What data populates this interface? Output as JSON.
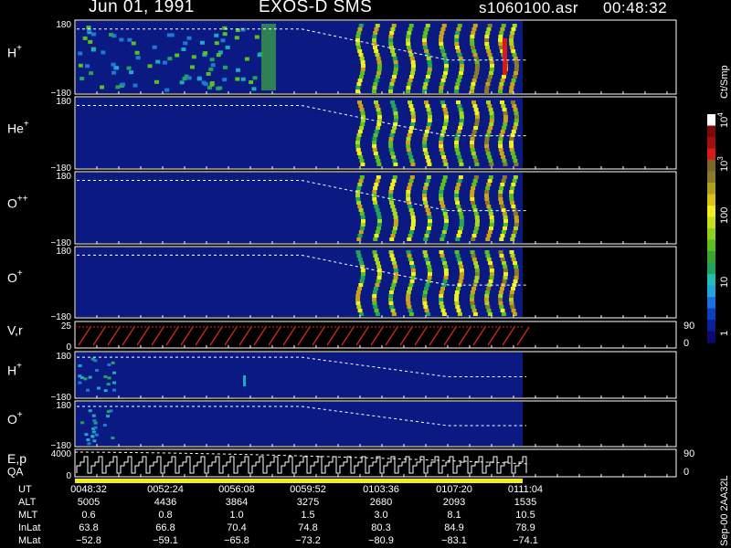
{
  "header": {
    "date": "Jun 01, 1991",
    "mission": "EXOS-D SMS",
    "file": "s1060100.asr",
    "time": "00:48:32"
  },
  "colorbar": {
    "unit": "Ct/Smp",
    "ticks": [
      "1",
      "10",
      "100",
      "10",
      "10"
    ],
    "tick_exponents": [
      "",
      "",
      "",
      "3",
      "4"
    ],
    "colors": [
      "#0b0b6e",
      "#0a1f9a",
      "#0a3fc2",
      "#1b6fe0",
      "#22a6d6",
      "#1fbfb8",
      "#22a45a",
      "#3aa62e",
      "#5bbf1d",
      "#8fd21a",
      "#c8e01c",
      "#f0ee1c",
      "#d9c21a",
      "#b0a020",
      "#8a7a2a",
      "#7a6a2a",
      "#d81a1a",
      "#a01010",
      "#7a0a0a",
      "#ffffff"
    ]
  },
  "side_text": "Sep-00  2AA32L",
  "chart_data": {
    "type": "heatmap",
    "panels": [
      {
        "label": "H",
        "sup": "+",
        "ymax": "180",
        "ymin": "−180",
        "kind": "spectrogram"
      },
      {
        "label": "He",
        "sup": "+",
        "ymax": "180",
        "ymin": "−180",
        "kind": "spectrogram"
      },
      {
        "label": "O",
        "sup": "++",
        "ymax": "180",
        "ymin": "−180",
        "kind": "spectrogram"
      },
      {
        "label": "O",
        "sup": "+",
        "ymax": "180",
        "ymin": "−180",
        "kind": "spectrogram"
      },
      {
        "label": "V,r",
        "sup": "",
        "ymax": "25",
        "ymin": "0",
        "kind": "sawtooth",
        "right_top": "90",
        "right_bottom": "0"
      },
      {
        "label": "H",
        "sup": "+",
        "ymax": "180",
        "ymin": "−180",
        "kind": "spectrogram2"
      },
      {
        "label": "O",
        "sup": "+",
        "ymax": "180",
        "ymin": "−180",
        "kind": "spectrogram2"
      },
      {
        "label": "E,p",
        "label2": "QA",
        "sup": "",
        "ymax": "4000",
        "ymin": "0",
        "kind": "steps",
        "right_top": "90",
        "right_bottom": "0"
      }
    ],
    "time_labels": [
      "0048:32",
      "0052:24",
      "0056:08",
      "0059:52",
      "0103:36",
      "0107:20",
      "0111:04"
    ],
    "rows": [
      {
        "name": "UT",
        "values": [
          "0048:32",
          "0052:24",
          "0056:08",
          "0059:52",
          "0103:36",
          "0107:20",
          "0111:04"
        ]
      },
      {
        "name": "ALT",
        "values": [
          "5005",
          "4436",
          "3864",
          "3275",
          "2680",
          "2093",
          "1535"
        ]
      },
      {
        "name": "MLT",
        "values": [
          "0.6",
          "0.8",
          "1.0",
          "1.5",
          "3.0",
          "8.1",
          "10.5"
        ]
      },
      {
        "name": "InLat",
        "values": [
          "63.8",
          "66.8",
          "70.4",
          "74.8",
          "80.3",
          "84.9",
          "78.9"
        ]
      },
      {
        "name": "MLat",
        "values": [
          "−52.8",
          "−59.1",
          "−65.8",
          "−73.2",
          "−80.9",
          "−83.1",
          "−74.1"
        ]
      }
    ],
    "xlim": [
      "0048:32",
      "0111:04"
    ]
  }
}
